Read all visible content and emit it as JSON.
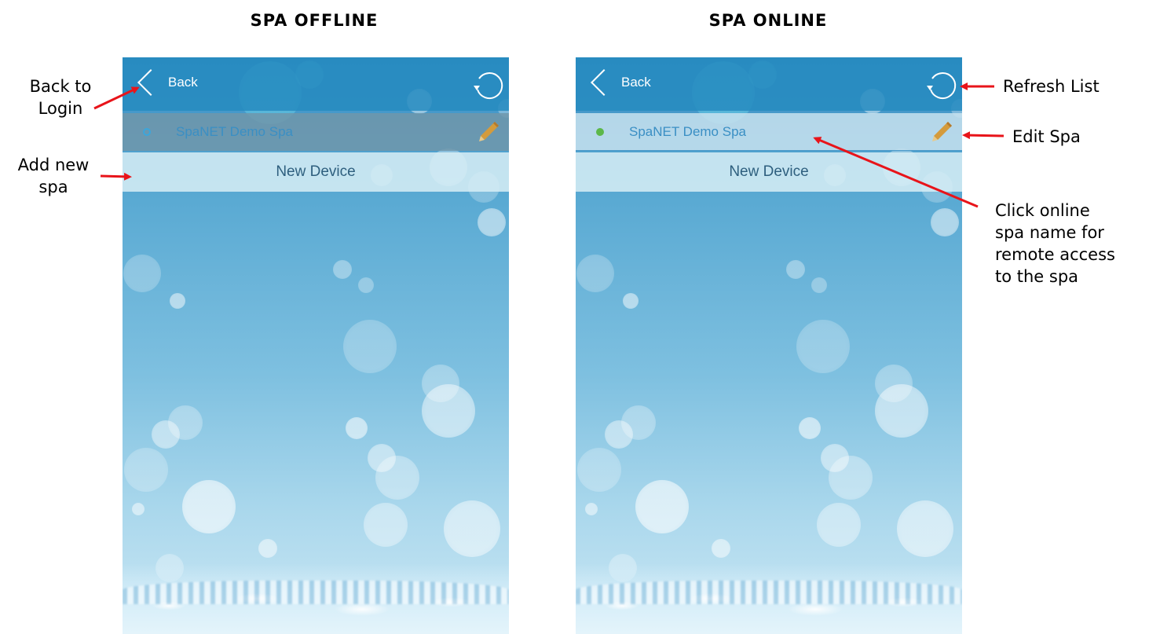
{
  "titles": {
    "left": "SPA OFFLINE",
    "right": "SPA ONLINE"
  },
  "app": {
    "back_label": "Back",
    "spa_name": "SpaNET Demo Spa",
    "new_device_label": "New Device"
  },
  "annotations": {
    "back": [
      "Back to",
      "Login"
    ],
    "add": [
      "Add new",
      "spa"
    ],
    "refresh": "Refresh List",
    "edit": "Edit Spa",
    "click": [
      "Click online",
      "spa name for",
      "remote access",
      "to the spa"
    ]
  },
  "colors": {
    "online_dot": "#5cb84a",
    "offline_dot": "#3aa6dc",
    "arrow": "#e8141a",
    "topbar": "#268bc0"
  },
  "icons": {
    "back": "chevron-left-icon",
    "refresh": "refresh-icon",
    "edit": "pencil-icon",
    "status": "status-dot-icon"
  },
  "states": {
    "left_online": false,
    "right_online": true
  }
}
